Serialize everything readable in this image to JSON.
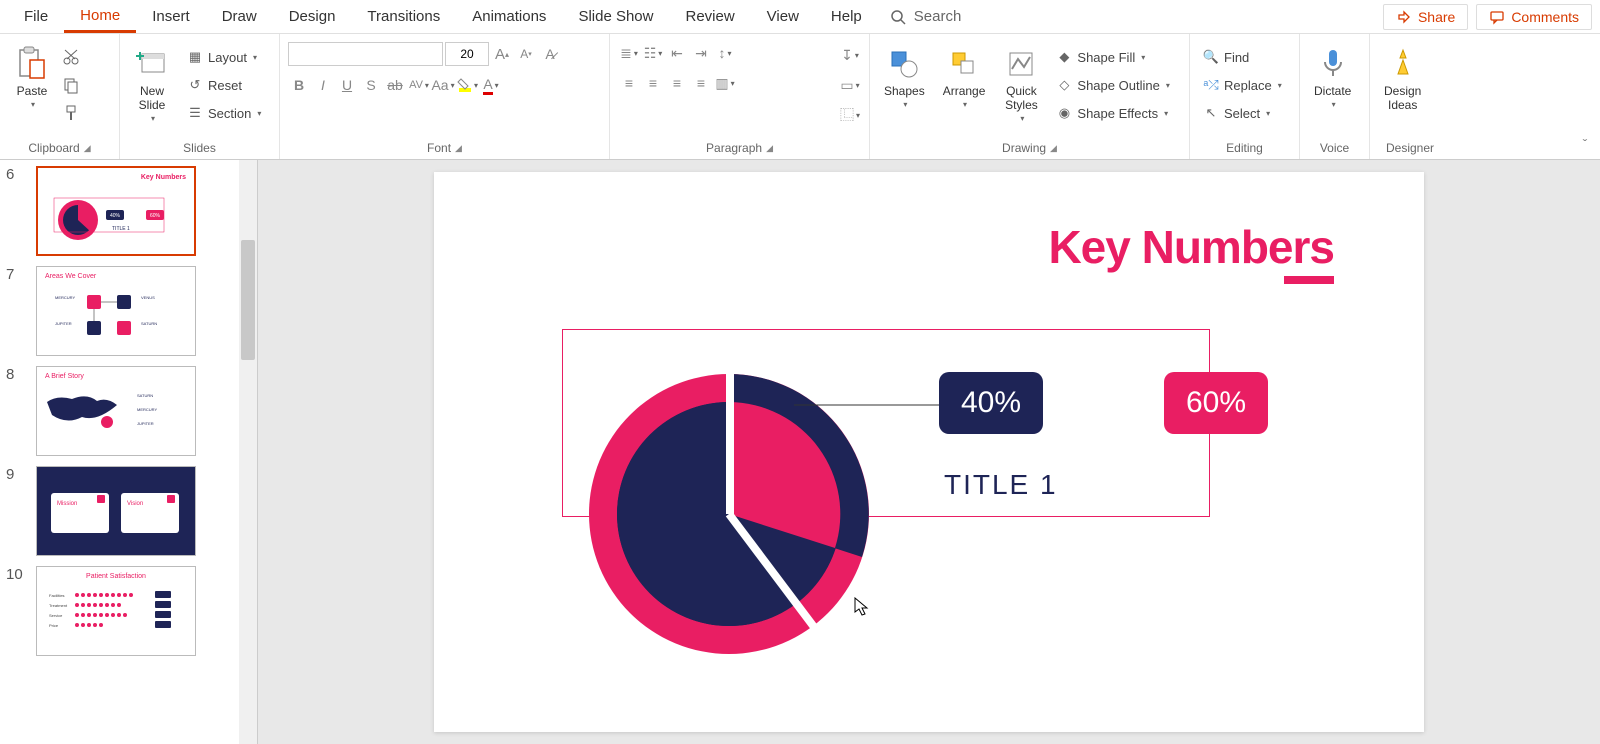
{
  "menu": {
    "items": [
      "File",
      "Home",
      "Insert",
      "Draw",
      "Design",
      "Transitions",
      "Animations",
      "Slide Show",
      "Review",
      "View",
      "Help"
    ],
    "search": "Search",
    "share": "Share",
    "comments": "Comments"
  },
  "ribbon": {
    "clipboard": {
      "paste": "Paste",
      "label": "Clipboard"
    },
    "slides": {
      "newSlide": "New\nSlide",
      "layout": "Layout",
      "reset": "Reset",
      "section": "Section",
      "label": "Slides"
    },
    "font": {
      "size": "20",
      "label": "Font"
    },
    "paragraph": {
      "label": "Paragraph"
    },
    "drawing": {
      "shapes": "Shapes",
      "arrange": "Arrange",
      "quickStyles": "Quick\nStyles",
      "shapeFill": "Shape Fill",
      "shapeOutline": "Shape Outline",
      "shapeEffects": "Shape Effects",
      "label": "Drawing"
    },
    "editing": {
      "find": "Find",
      "replace": "Replace",
      "select": "Select",
      "label": "Editing"
    },
    "voice": {
      "dictate": "Dictate",
      "label": "Voice"
    },
    "designer": {
      "designIdeas": "Design\nIdeas",
      "label": "Designer"
    }
  },
  "thumbnails": [
    {
      "num": "6",
      "title": "Key Numbers",
      "active": true
    },
    {
      "num": "7",
      "title": "Areas We Cover"
    },
    {
      "num": "8",
      "title": "A Brief Story"
    },
    {
      "num": "9",
      "title": ""
    },
    {
      "num": "10",
      "title": "Patient Satisfaction"
    }
  ],
  "slide": {
    "title": "Key Numbers",
    "label40": "40%",
    "label60": "60%",
    "subtitle": "TITLE 1"
  },
  "chart_data": {
    "type": "pie",
    "title": "Key Numbers",
    "series": [
      {
        "name": "TITLE 1",
        "values": [
          {
            "label": "40%",
            "value": 40,
            "color": "#1e2456"
          },
          {
            "label": "60%",
            "value": 60,
            "color": "#e91e63"
          }
        ]
      }
    ]
  }
}
